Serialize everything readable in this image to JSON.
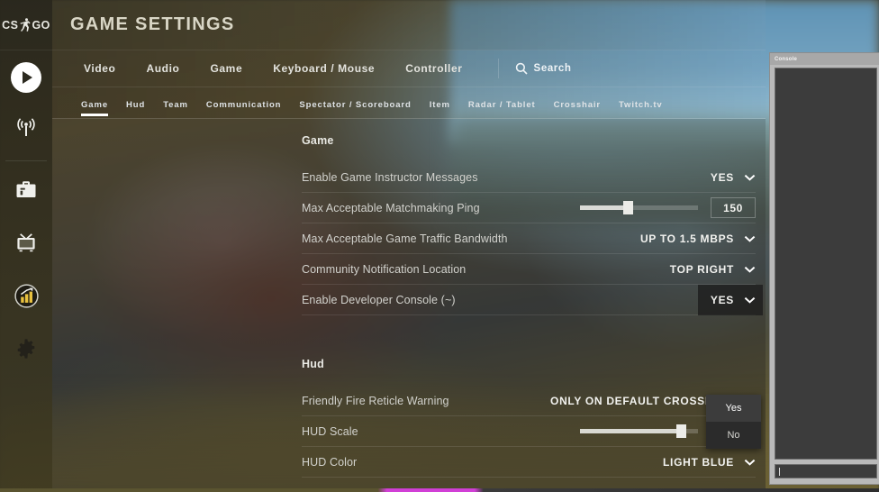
{
  "app": {
    "logo_text_left": "CS",
    "logo_text_right": "GO",
    "logo_name": "csgo-logo"
  },
  "header": {
    "title": "GAME SETTINGS"
  },
  "rail": {
    "items": [
      {
        "name": "play-icon",
        "label": "Play"
      },
      {
        "name": "broadcast-icon",
        "label": "Broadcast"
      },
      {
        "name": "inventory-icon",
        "label": "Inventory"
      },
      {
        "name": "watch-icon",
        "label": "Watch"
      },
      {
        "name": "stats-icon",
        "label": "Stats"
      },
      {
        "name": "settings-icon",
        "label": "Settings"
      }
    ]
  },
  "main_tabs": [
    {
      "label": "Video",
      "selected": false
    },
    {
      "label": "Audio",
      "selected": false
    },
    {
      "label": "Game",
      "selected": true
    },
    {
      "label": "Keyboard / Mouse",
      "selected": false
    },
    {
      "label": "Controller",
      "selected": false
    }
  ],
  "search": {
    "label": "Search",
    "icon": "search-icon"
  },
  "sub_tabs": [
    {
      "label": "Game",
      "selected": true
    },
    {
      "label": "Hud",
      "selected": false
    },
    {
      "label": "Team",
      "selected": false
    },
    {
      "label": "Communication",
      "selected": false
    },
    {
      "label": "Spectator / Scoreboard",
      "selected": false
    },
    {
      "label": "Item",
      "selected": false
    },
    {
      "label": "Radar / Tablet",
      "selected": false
    },
    {
      "label": "Crosshair",
      "selected": false
    },
    {
      "label": "Twitch.tv",
      "selected": false
    }
  ],
  "sections": {
    "game": {
      "heading": "Game",
      "rows": [
        {
          "label": "Enable Game Instructor Messages",
          "type": "dropdown",
          "value": "YES"
        },
        {
          "label": "Max Acceptable Matchmaking Ping",
          "type": "slider",
          "value": "150",
          "percent": 40
        },
        {
          "label": "Max Acceptable Game Traffic Bandwidth",
          "type": "dropdown",
          "value": "UP TO 1.5 MBPS"
        },
        {
          "label": "Community Notification Location",
          "type": "dropdown",
          "value": "TOP RIGHT"
        },
        {
          "label": "Enable Developer Console (~)",
          "type": "dropdown",
          "value": "YES",
          "open": true
        }
      ]
    },
    "hud": {
      "heading": "Hud",
      "rows": [
        {
          "label": "Friendly Fire Reticle Warning",
          "type": "dropdown",
          "value": "ONLY ON DEFAULT CROSSHAIR"
        },
        {
          "label": "HUD Scale",
          "type": "slider",
          "value": "0.90",
          "percent": 85
        },
        {
          "label": "HUD Color",
          "type": "dropdown",
          "value": "LIGHT BLUE"
        }
      ]
    }
  },
  "dropdown_menu": {
    "options": [
      {
        "label": "Yes",
        "selected": true
      },
      {
        "label": "No",
        "selected": false
      }
    ]
  },
  "console": {
    "title": "Console",
    "input_value": ""
  },
  "colors": {
    "accent_white": "#ffffff",
    "label_text": "#d2d2cd",
    "value_text": "#f2f2ef",
    "title_text": "#d9d6c6",
    "stats_gold": "#e8c13f",
    "console_chrome": "#b9b9b9",
    "console_field": "#3c3c3c"
  }
}
